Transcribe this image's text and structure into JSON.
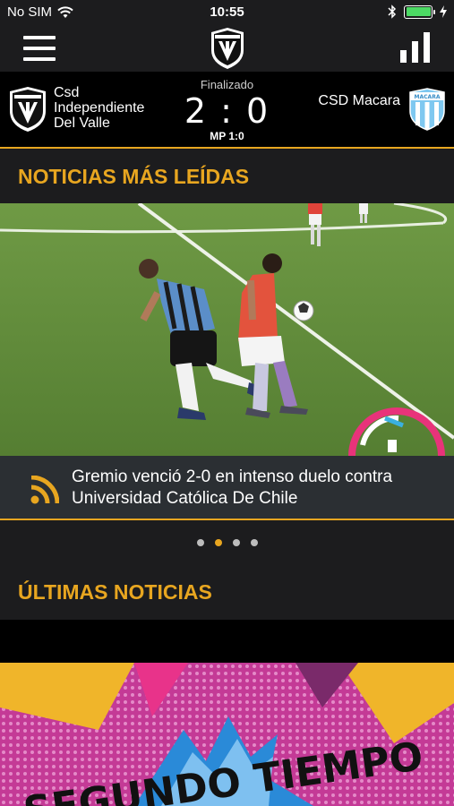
{
  "status_bar": {
    "carrier": "No SIM",
    "time": "10:55",
    "icons": [
      "wifi-icon",
      "bluetooth-icon",
      "battery-icon",
      "charging-icon"
    ]
  },
  "nav": {
    "menu_icon": "hamburger-menu-icon",
    "logo": "club-crest-logo",
    "stats_icon": "bar-chart-icon"
  },
  "match": {
    "status": "Finalizado",
    "score": "2 : 0",
    "halftime": "MP 1:0",
    "home_team": "Csd Independiente Del Valle",
    "away_team": "CSD Macara",
    "away_crest_text": "MACARA"
  },
  "sections": {
    "most_read_title": "NOTICIAS MÁS LEÍDAS",
    "latest_title": "ÚLTIMAS NOTICIAS"
  },
  "featured": {
    "headline": "Gremio venció 2-0 en intenso duelo contra Universidad Católica De Chile",
    "icon": "rss-icon",
    "carousel_total": 4,
    "carousel_active": 2
  },
  "latest_card": {
    "art_text": "SEGUNDO TIEMPO"
  },
  "colors": {
    "accent": "#e8a620",
    "background": "#1c1c1e",
    "caption_bg": "#2b2f33"
  }
}
